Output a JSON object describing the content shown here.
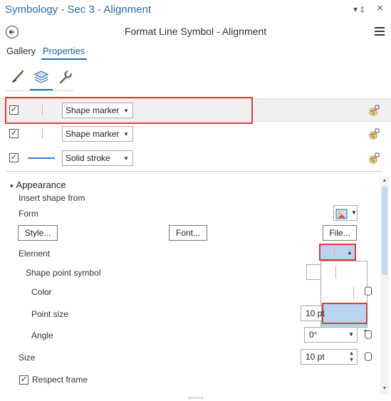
{
  "window": {
    "title": "Symbology - Sec 3 - Alignment",
    "pin_glyph": "▾ ‡",
    "close_glyph": "×"
  },
  "header": {
    "title": "Format Line Symbol - Alignment"
  },
  "tabs": [
    {
      "label": "Gallery",
      "active": false
    },
    {
      "label": "Properties",
      "active": true
    }
  ],
  "icon_tabs": [
    "paintbrush-icon",
    "layers-icon",
    "wrench-icon"
  ],
  "layers": [
    {
      "checked": true,
      "preview": "vertical-tick",
      "type": "Shape marker",
      "highlighted": true
    },
    {
      "checked": true,
      "preview": "vertical-tick",
      "type": "Shape marker",
      "highlighted": false
    },
    {
      "checked": true,
      "preview": "solid-line",
      "type": "Solid stroke",
      "highlighted": false
    }
  ],
  "appearance": {
    "section_title": "Appearance",
    "insert_shape_from": "Insert shape from",
    "form_label": "Form",
    "style_button": "Style...",
    "font_button": "Font...",
    "file_button": "File...",
    "element_label": "Element",
    "shape_point_symbol_label": "Shape point symbol",
    "color_label": "Color",
    "point_size_label": "Point size",
    "point_size_value": "10 pt",
    "angle_label": "Angle",
    "angle_value": "0°",
    "size_label": "Size",
    "size_value": "10 pt",
    "respect_frame_label": "Respect frame",
    "respect_frame_checked": true
  },
  "colors": {
    "accent": "#1f6fb5",
    "title_text": "#2a6bb0",
    "highlight_red": "#e03b3b",
    "selection_blue": "#b9d4ee",
    "marker_pink": "#f3a3a3"
  }
}
